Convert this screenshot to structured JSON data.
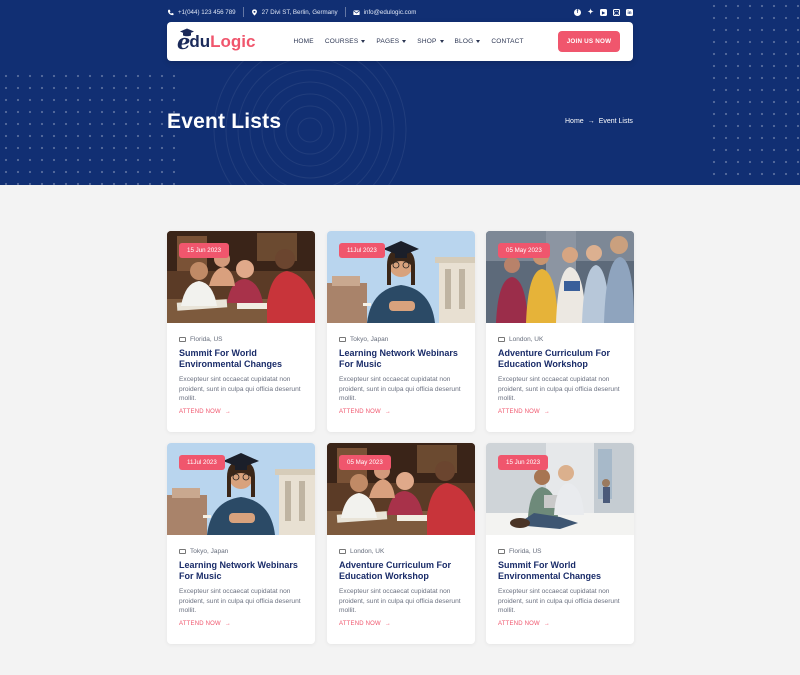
{
  "topbar": {
    "phone": "+1(044) 123 456 789",
    "address": "27 Divi ST, Berlin, Germany",
    "email": "info@edulogic.com",
    "social_icons": [
      "facebook-icon",
      "twitter-icon",
      "youtube-icon",
      "instagram-icon",
      "linkedin-icon"
    ]
  },
  "logo": {
    "part1": "edu",
    "part2": "Logic"
  },
  "nav": {
    "home": "HOME",
    "courses": "COURSES",
    "pages": "PAGES",
    "shop": "SHOP",
    "blog": "BLOG",
    "contact": "CONTACT",
    "join": "JOIN US NOW"
  },
  "page_title": "Event Lists",
  "breadcrumb": {
    "home": "Home",
    "separator": "→",
    "current": "Event Lists"
  },
  "cta_label": "ATTEND NOW",
  "cta_arrow": "→",
  "colors": {
    "brand_navy": "#112f73",
    "accent": "#f0566d",
    "title": "#1a2c69"
  },
  "events": [
    {
      "date": "15 Jun 2023",
      "location": "Florida, US",
      "title": "Summit For World Environmental Changes",
      "excerpt": "Excepteur sint occaecat cupidatat non proident, sunt in culpa qui officia deserunt mollit.",
      "image": "students-studying"
    },
    {
      "date": "11Jul 2023",
      "location": "Tokyo, Japan",
      "title": "Learning Network Webinars For Music",
      "excerpt": "Excepteur sint occaecat cupidatat non proident, sunt in culpa qui officia deserunt mollit.",
      "image": "graduate-portrait"
    },
    {
      "date": "05 May 2023",
      "location": "London, UK",
      "title": "Adventure Curriculum For Education Workshop",
      "excerpt": "Excepteur sint occaecat cupidatat non proident, sunt in culpa qui officia deserunt mollit.",
      "image": "students-group"
    },
    {
      "date": "11Jul 2023",
      "location": "Tokyo, Japan",
      "title": "Learning Network Webinars For Music",
      "excerpt": "Excepteur sint occaecat cupidatat non proident, sunt in culpa qui officia deserunt mollit.",
      "image": "graduate-portrait"
    },
    {
      "date": "05 May 2023",
      "location": "London, UK",
      "title": "Adventure Curriculum For Education Workshop",
      "excerpt": "Excepteur sint occaecat cupidatat non proident, sunt in culpa qui officia deserunt mollit.",
      "image": "students-studying"
    },
    {
      "date": "15 Jun 2023",
      "location": "Florida, US",
      "title": "Summit For World Environmental Changes",
      "excerpt": "Excepteur sint occaecat cupidatat non proident, sunt in culpa qui officia deserunt mollit.",
      "image": "students-hallway"
    }
  ]
}
